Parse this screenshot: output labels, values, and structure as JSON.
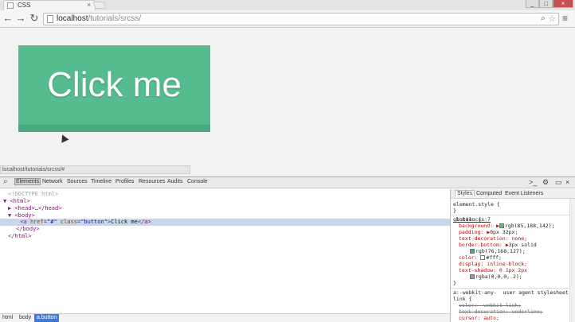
{
  "tab": {
    "title": "CSS",
    "close": "×"
  },
  "window": {
    "minimize": "_",
    "maximize": "□",
    "close": "×"
  },
  "toolbar": {
    "back": "←",
    "forward": "→",
    "reload": "↻",
    "url_host": "localhost",
    "url_path": "/tutorials/srcss/",
    "search_glyph": "⌕",
    "star_glyph": "☆",
    "menu_glyph": "≡"
  },
  "page": {
    "button_label": "Click me",
    "status_url": "localhost/tutorials/srcss/#"
  },
  "devtools": {
    "tabs": [
      "Elements",
      "Network",
      "Sources",
      "Timeline",
      "Profiles",
      "Resources",
      "Audits",
      "Console"
    ],
    "right_icons": {
      "console": ">_",
      "settings": "⚙",
      "dock": "▭",
      "close": "×"
    },
    "dom": {
      "doctype": "<!DOCTYPE html>",
      "html_open": "<html>",
      "head": "<head>…</head>",
      "body_open": "<body>",
      "a_tag_open": "<a",
      "a_attr1_name": "href",
      "a_attr1_val": "\"#\"",
      "a_attr2_name": "class",
      "a_attr2_val": "\"button\"",
      "a_text": "Click me",
      "a_tag_close": "</a>",
      "body_close": "</body>",
      "html_close": "</html>"
    },
    "breadcrumbs": [
      "html",
      "body",
      "a.button"
    ],
    "sidebar": {
      "tabs": [
        "Styles",
        "Computed",
        "Event Listeners"
      ],
      "element_style": "element.style {",
      "element_style_close": "}",
      "rule_selector": ".button {",
      "rule_source": "global.css:7",
      "props": {
        "background": "background: ▶",
        "background_val": "rgb(85,188,142);",
        "padding": "padding: ▶",
        "padding_val": "0px 32px;",
        "text_decoration": "text-decoration: none;",
        "border_bottom": "border-bottom: ▶",
        "border_bottom_val": "3px solid",
        "border_bottom_color": "rgb(76,168,127);",
        "color": "color:",
        "color_val": "#fff;",
        "display": "display: inline-block;",
        "text_shadow": "text-shadow: 0 1px 2px",
        "text_shadow_color": "rgba(0,0,0,.2);"
      },
      "rule_close": "}",
      "ua_selector": "a:-webkit-any-  user agent stylesheet",
      "ua_selector2": "link {",
      "ua_color": "color: -webkit-link;",
      "ua_decoration": "text-decoration: underline;",
      "ua_cursor": "cursor: auto;"
    },
    "colors": {
      "button": "#55bc8e",
      "button_border": "#4ca87f",
      "selected_row": "#c8d7ea",
      "active_crumb": "#3b7be5"
    }
  }
}
